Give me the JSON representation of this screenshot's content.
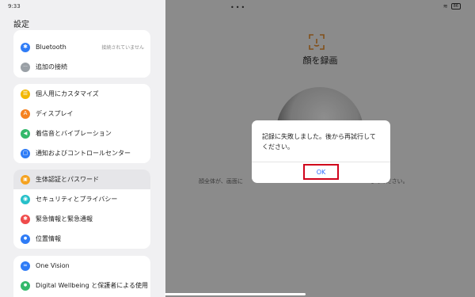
{
  "status_bar": {
    "time": "9:33",
    "battery": "86"
  },
  "settings": {
    "title": "設定",
    "groups": [
      {
        "items": [
          {
            "label": "Bluetooth",
            "icon": "bluetooth-icon",
            "icon_glyph": "✱",
            "color": "#2f7cf6",
            "status": "接続されていません"
          },
          {
            "label": "追加の接続",
            "icon": "more-connections-icon",
            "icon_glyph": "···",
            "color": "#9aa0a6"
          }
        ]
      },
      {
        "items": [
          {
            "label": "個人用にカスタマイズ",
            "icon": "customize-icon",
            "icon_glyph": "☰",
            "color": "#f2b705"
          },
          {
            "label": "ディスプレイ",
            "icon": "display-icon",
            "icon_glyph": "A",
            "color": "#f5821f"
          },
          {
            "label": "着信音とバイブレーション",
            "icon": "sound-icon",
            "icon_glyph": "◀",
            "color": "#34b96b"
          },
          {
            "label": "通知およびコントロールセンター",
            "icon": "notification-icon",
            "icon_glyph": "▢",
            "color": "#2f7cf6"
          }
        ]
      },
      {
        "items": [
          {
            "label": "生体認証とパスワード",
            "icon": "lock-icon",
            "icon_glyph": "▣",
            "color": "#f5a21f",
            "selected": true
          },
          {
            "label": "セキュリティとプライバシー",
            "icon": "security-icon",
            "icon_glyph": "◉",
            "color": "#26c0c9"
          },
          {
            "label": "緊急情報と緊急通報",
            "icon": "emergency-icon",
            "icon_glyph": "✱",
            "color": "#ef4b4b"
          },
          {
            "label": "位置情報",
            "icon": "location-icon",
            "icon_glyph": "●",
            "color": "#2f7cf6"
          }
        ]
      },
      {
        "items": [
          {
            "label": "One Vision",
            "icon": "one-vision-icon",
            "icon_glyph": "∞",
            "color": "#2f7cf6"
          },
          {
            "label": "Digital Wellbeing と保護者による使用",
            "icon": "wellbeing-icon",
            "icon_glyph": "●",
            "color": "#34b96b"
          }
        ]
      }
    ]
  },
  "detail": {
    "title": "顔を録画",
    "hint_left": "顔全体が、画面に",
    "hint_right": "してください。"
  },
  "dialog": {
    "message": "記録に失敗しました。後から再試行してください。",
    "ok_label": "OK"
  }
}
